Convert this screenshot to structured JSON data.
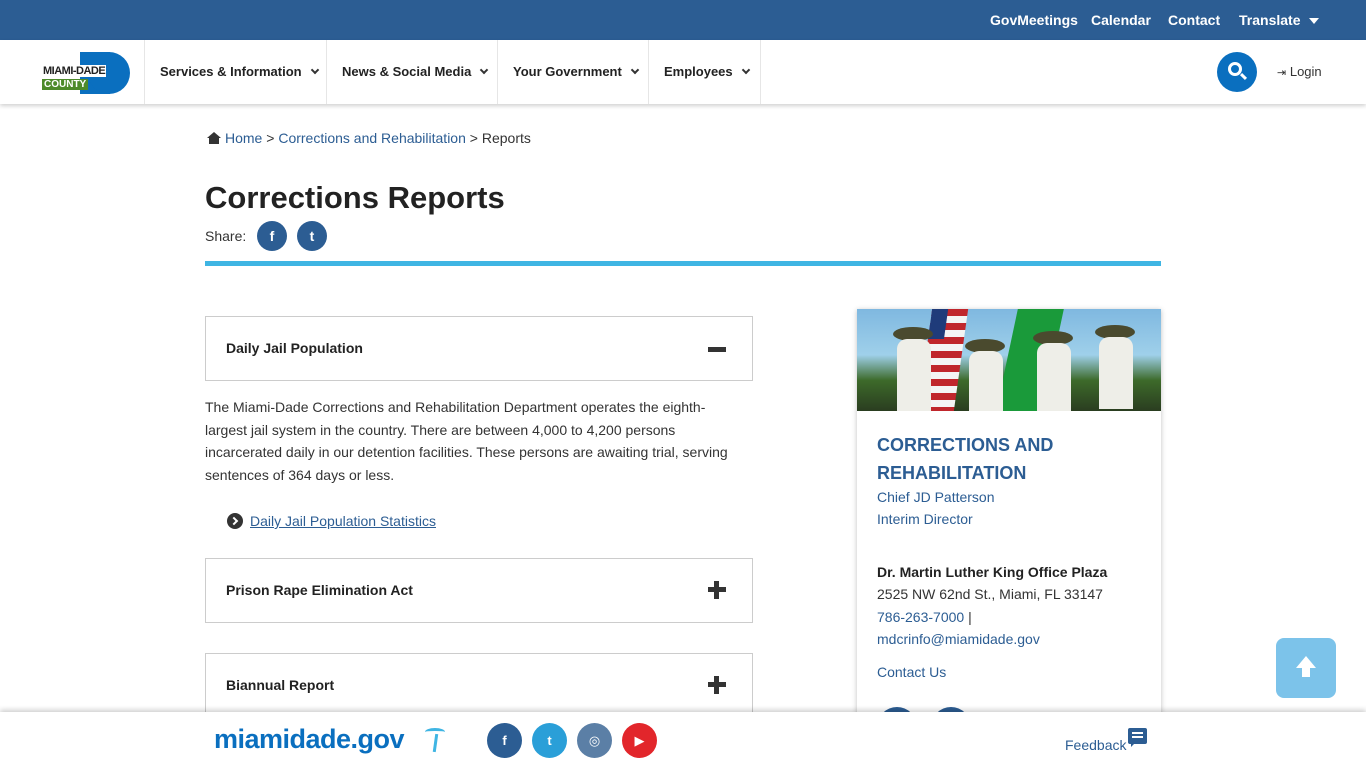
{
  "topbar": {
    "links": [
      "GovMeetings",
      "Calendar",
      "Contact"
    ],
    "translate": "Translate"
  },
  "logo": {
    "line1": "MIAMI-DADE",
    "line2": "COUNTY"
  },
  "nav": {
    "items": [
      "Services & Information",
      "News & Social Media",
      "Your Government",
      "Employees"
    ],
    "login": "Login"
  },
  "breadcrumb": {
    "home": "Home",
    "sep": ">",
    "parent": "Corrections and Rehabilitation",
    "current": "Reports"
  },
  "page": {
    "title": "Corrections Reports",
    "share_label": "Share:",
    "share_facebook": "f",
    "share_twitter": "t"
  },
  "accordions": [
    {
      "label": "Daily Jail Population",
      "expanded": true,
      "body": "The Miami-Dade Corrections and Rehabilitation Department operates the eighth-largest jail system in the country. There are between 4,000 to 4,200 persons incarcerated daily in our detention facilities. These persons are awaiting trial, serving sentences of 364 days or less.",
      "link": "Daily Jail Population Statistics"
    },
    {
      "label": "Prison Rape Elimination Act",
      "expanded": false
    },
    {
      "label": "Biannual Report",
      "expanded": false
    }
  ],
  "sidebar": {
    "title": "CORRECTIONS AND REHABILITATION",
    "chief": "Chief JD Patterson",
    "role": "Interim Director",
    "office": "Dr. Martin Luther King Office Plaza",
    "address": "2525 NW 62nd St., Miami, FL 33147",
    "phone": "786-263-7000",
    "phone_sep": " |",
    "email": "mdcrinfo@miamidade.gov",
    "contact": "Contact Us"
  },
  "footer": {
    "brand": "miamidade.gov",
    "social": [
      {
        "name": "facebook",
        "glyph": "f",
        "color": "#2c5d93"
      },
      {
        "name": "twitter",
        "glyph": "t",
        "color": "#2a9fd8"
      },
      {
        "name": "instagram",
        "glyph": "◎",
        "color": "#5b7fa6"
      },
      {
        "name": "youtube",
        "glyph": "▶",
        "color": "#e2262b"
      }
    ],
    "feedback": "Feedback"
  },
  "colors": {
    "brand_blue": "#2c5d93",
    "accent_cyan": "#3fb5e3",
    "logo_blue": "#0a6fbf"
  }
}
